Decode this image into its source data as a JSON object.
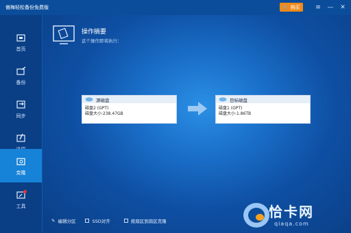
{
  "app": {
    "title": "傲梅轻松备份免费版",
    "buy_label": "购买"
  },
  "window": {
    "menu_icon": "≡",
    "minimize_icon": "—",
    "close_icon": "✕"
  },
  "sidebar": {
    "items": [
      {
        "label": "首页",
        "icon": "home-icon"
      },
      {
        "label": "备份",
        "icon": "backup-icon"
      },
      {
        "label": "同步",
        "icon": "sync-icon"
      },
      {
        "label": "还原",
        "icon": "restore-icon"
      },
      {
        "label": "克隆",
        "icon": "clone-icon",
        "active": true
      },
      {
        "label": "工具",
        "icon": "tools-icon"
      }
    ]
  },
  "summary": {
    "title": "操作摘要",
    "subtitle": "这个操作即将执行："
  },
  "source_disk": {
    "header": "源磁盘",
    "line1": "磁盘2 (GPT)",
    "line2": "磁盘大小:238.47GB"
  },
  "target_disk": {
    "header": "目标磁盘",
    "line1": "磁盘1 (GPT)",
    "line2": "磁盘大小:1.86TB"
  },
  "options": {
    "edit_partition": "编辑分区",
    "ssd_align": "SSD对齐",
    "sector_clone": "按扇区到扇区克隆"
  },
  "watermark": {
    "brand": "恰卡网",
    "url": "qiaqa.com"
  },
  "colors": {
    "accent": "#1682d8",
    "buy": "#f08a1c"
  }
}
